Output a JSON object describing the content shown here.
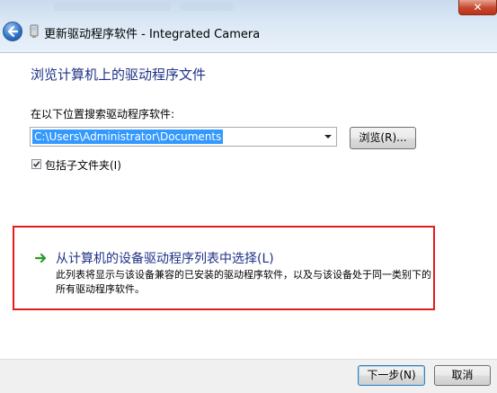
{
  "window": {
    "title": "更新驱动程序软件 - Integrated Camera",
    "close_glyph": "✕"
  },
  "page": {
    "heading": "浏览计算机上的驱动程序文件",
    "search_label": "在以下位置搜索驱动程序软件:",
    "path_value": "C:\\Users\\Administrator\\Documents",
    "browse_label": "浏览(R)...",
    "include_subfolders_label": "包括子文件夹(I)",
    "include_subfolders_checked": true
  },
  "pick_option": {
    "title": "从计算机的设备驱动程序列表中选择(L)",
    "description": "此列表将显示与该设备兼容的已安装的驱动程序软件，以及与该设备处于同一类别下的所有驱动程序软件。"
  },
  "footer": {
    "next_label": "下一步(N)",
    "cancel_label": "取消"
  },
  "colors": {
    "heading": "#1e3287",
    "highlight_box": "#e51b1b",
    "selection": "#3399ff",
    "arrow": "#2e9b2e"
  },
  "icons": [
    "back-arrow-icon",
    "device-icon",
    "close-icon",
    "dropdown-arrow-icon",
    "checkmark-icon",
    "green-arrow-icon"
  ]
}
